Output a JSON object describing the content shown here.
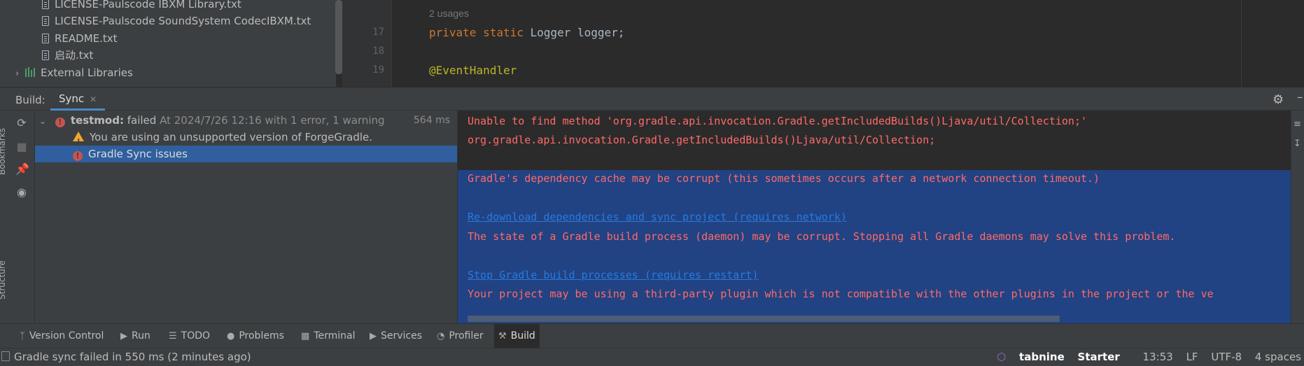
{
  "project_tree": {
    "files": [
      "LICENSE-Paulscode IBXM Library.txt",
      "LICENSE-Paulscode SoundSystem CodecIBXM.txt",
      "README.txt",
      "启动.txt"
    ],
    "external_libraries": "External Libraries"
  },
  "editor": {
    "usages_hint": "2 usages",
    "lines": [
      {
        "num": "17",
        "kw": "private static ",
        "rest": "Logger logger;"
      },
      {
        "num": "18",
        "kw": "",
        "rest": ""
      },
      {
        "num": "19",
        "ann": "@EventHandler"
      }
    ]
  },
  "build_window": {
    "title": "Build:",
    "tab": "Sync",
    "tree": {
      "root_name": "testmod:",
      "root_status": "failed",
      "root_detail": "At 2024/7/26 12:16 with 1 error, 1 warning",
      "root_time": "564 ms",
      "warning": "You are using an unsupported version of ForgeGradle.",
      "issue": "Gradle Sync issues"
    },
    "side_tabs": {
      "bookmarks": "Bookmarks",
      "structure": "Structure"
    }
  },
  "console": {
    "lines": [
      "Unable to find method 'org.gradle.api.invocation.Gradle.getIncludedBuilds()Ljava/util/Collection;'",
      "org.gradle.api.invocation.Gradle.getIncludedBuilds()Ljava/util/Collection;",
      "Gradle's dependency cache may be corrupt (this sometimes occurs after a network connection timeout.)",
      "The state of a Gradle build process (daemon) may be corrupt. Stopping all Gradle daemons may solve this problem.",
      "Your project may be using a third-party plugin which is not compatible with the other plugins in the project or the ve"
    ],
    "links": [
      "Re-download dependencies and sync project (requires network)",
      "Stop Gradle build processes (requires restart)"
    ]
  },
  "tool_windows": [
    "Version Control",
    "Run",
    "TODO",
    "Problems",
    "Terminal",
    "Services",
    "Profiler",
    "Build"
  ],
  "status_bar": {
    "message": "Gradle sync failed in 550 ms (2 minutes ago)",
    "tabnine": "tabnine",
    "tabnine_plan": "Starter",
    "position": "13:53",
    "line_sep": "LF",
    "encoding": "UTF-8",
    "indent": "4 spaces"
  },
  "colors": {
    "error": "#ff6b68",
    "link": "#287bde",
    "selection": "#214283",
    "accent": "#4a88c7"
  }
}
